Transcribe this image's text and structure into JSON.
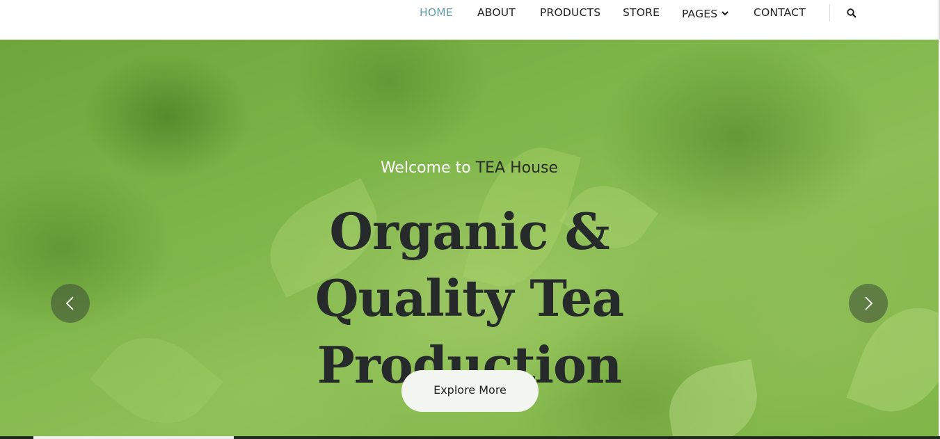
{
  "nav": {
    "items": [
      {
        "label": "HOME",
        "active": true
      },
      {
        "label": "ABOUT",
        "active": false
      },
      {
        "label": "PRODUCTS",
        "active": false
      },
      {
        "label": "STORE",
        "active": false
      },
      {
        "label": "PAGES",
        "active": false
      },
      {
        "label": "CONTACT",
        "active": false
      }
    ],
    "search_icon": "search-icon",
    "pages_icon": "chevron-down-icon"
  },
  "hero": {
    "welcome_prefix": "Welcome to",
    "welcome_brand": "TEA House",
    "headline": [
      "Organic &",
      "Quality Tea",
      "Production"
    ],
    "cta_label": "Explore More",
    "prev_icon": "chevron-left-icon",
    "next_icon": "chevron-right-icon"
  },
  "colors": {
    "active_nav": "#5f9ea6",
    "headline": "#262a2a",
    "hero_green": "#7db549"
  }
}
